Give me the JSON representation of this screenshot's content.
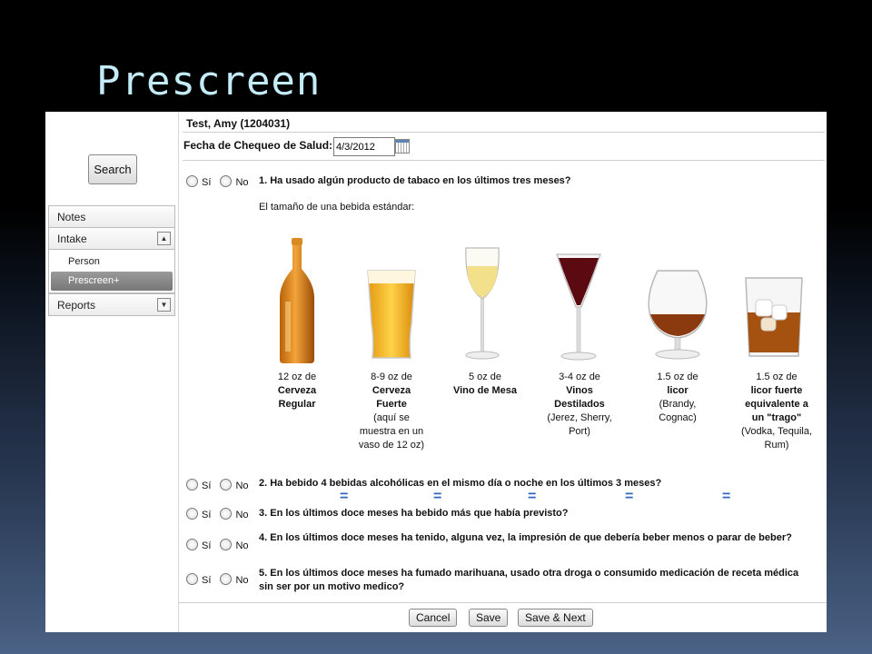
{
  "slide": {
    "title": "Prescreen"
  },
  "sidebar": {
    "search_label": "Search",
    "nav": [
      {
        "label": "Notes"
      },
      {
        "label": "Intake",
        "toggle": "collapse",
        "children": [
          {
            "label": "Person"
          },
          {
            "label": "Prescreen+",
            "active": true
          }
        ]
      },
      {
        "label": "Reports",
        "toggle": "expand"
      }
    ]
  },
  "header": {
    "patient": "Test, Amy (1204031)"
  },
  "date_field": {
    "label": "Fecha de Chequeo de Salud:",
    "value": "4/3/2012"
  },
  "radio_labels": {
    "yes": "Sí",
    "no": "No"
  },
  "questions": [
    {
      "text": "1. Ha usado algún producto de tabaco en los últimos tres meses?"
    },
    {
      "text": "2. Ha bebido 4 bebidas alcohólicas en el mismo día o noche en los últimos 3 meses?"
    },
    {
      "text": "3. En los últimos doce meses ha bebido más que había previsto?"
    },
    {
      "text": "4. En los últimos doce meses ha tenido, alguna vez, la impresión de que debería beber menos o parar de beber?"
    },
    {
      "text": "5. En los últimos doce meses ha fumado marihuana, usado otra droga o consumido medicación de receta médica sin ser por un motivo medico?"
    }
  ],
  "drink_intro": "El tamaño de una bebida estándar:",
  "equals": "=",
  "drinks": [
    {
      "icon": "beer-bottle-icon",
      "amount": "12 oz de",
      "name": "Cerveza Regular",
      "note": ""
    },
    {
      "icon": "beer-glass-icon",
      "amount": "8-9 oz de",
      "name": "Cerveza Fuerte",
      "note": "(aquí se muestra en un vaso de 12 oz)"
    },
    {
      "icon": "wine-glass-icon",
      "amount": "5 oz de",
      "name": "Vino de Mesa",
      "note": ""
    },
    {
      "icon": "cordial-glass-icon",
      "amount": "3-4 oz de",
      "name": "Vinos Destilados",
      "note": "(Jerez, Sherry, Port)"
    },
    {
      "icon": "brandy-snifter-icon",
      "amount": "1.5 oz de",
      "name": "licor",
      "note": "(Brandy, Cognac)"
    },
    {
      "icon": "rocks-glass-icon",
      "amount": "1.5 oz de",
      "name": "licor fuerte equivalente a un \"trago\"",
      "note": "(Vodka, Tequila, Rum)"
    }
  ],
  "buttons": {
    "cancel": "Cancel",
    "save": "Save",
    "save_next": "Save & Next"
  },
  "colors": {
    "equals": "#3366bb",
    "active_nav": "#888888",
    "title": "#c4ecf8"
  }
}
